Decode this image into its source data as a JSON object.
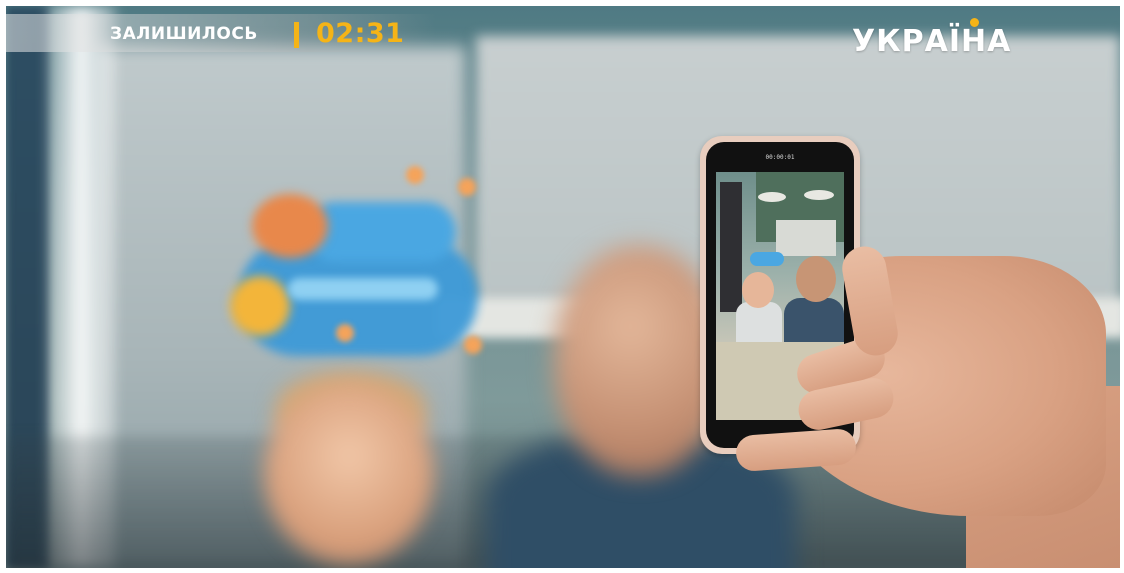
{
  "overlay": {
    "remaining_label": "ЗАЛИШИЛОСЬ",
    "timer": "02:31",
    "channel_logo": "УКРАЇНА",
    "accent_color": "#f5b417"
  },
  "phone": {
    "recording_time": "00:00:01"
  }
}
